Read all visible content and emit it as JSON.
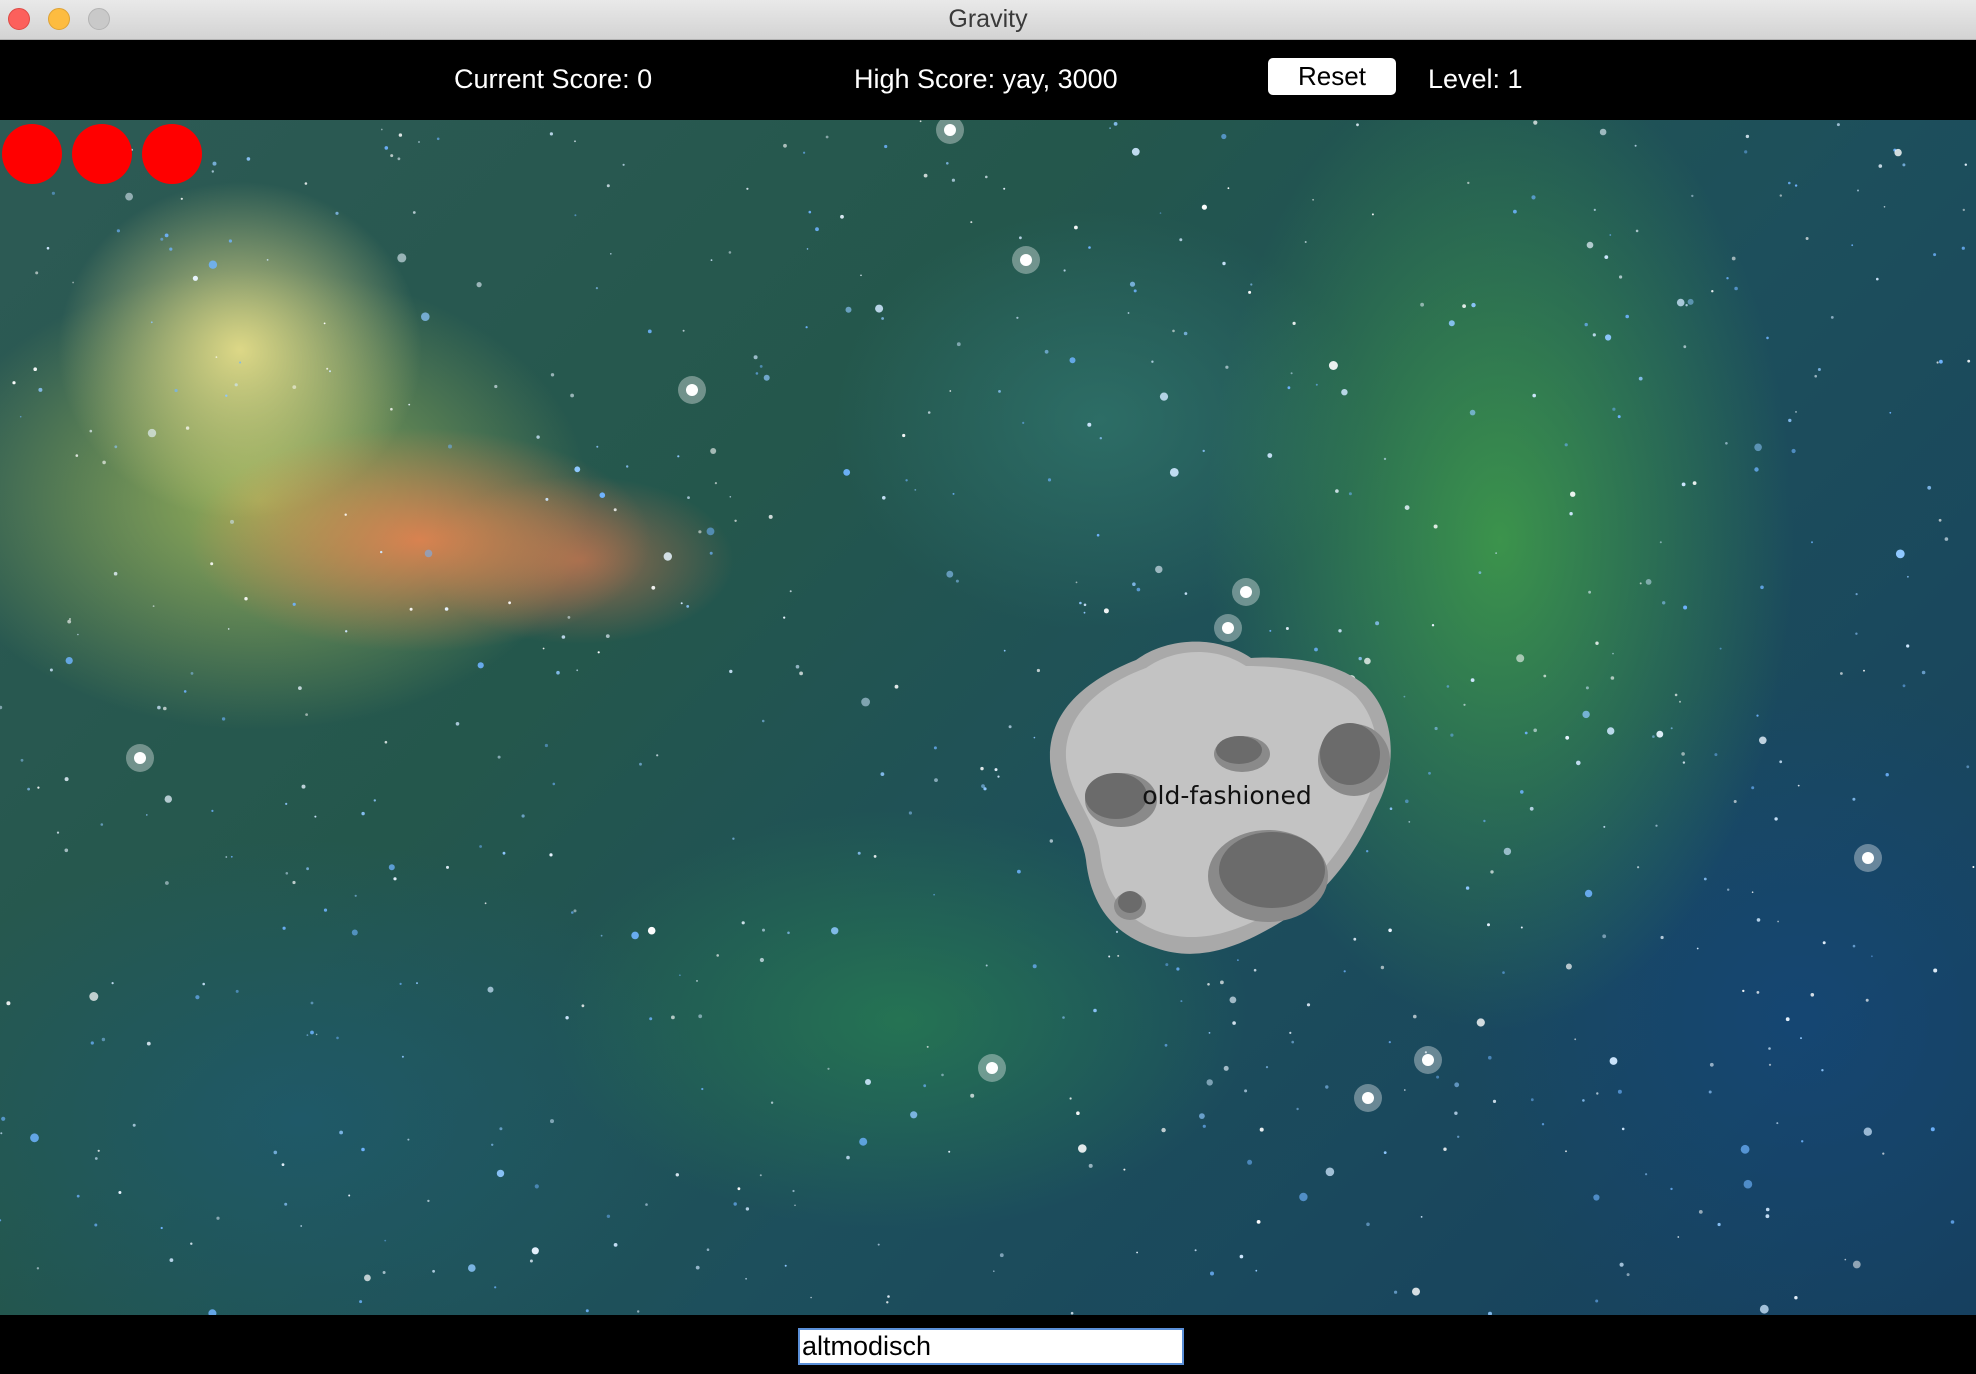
{
  "window": {
    "title": "Gravity"
  },
  "scorebar": {
    "current_score": "Current Score: 0",
    "high_score": "High Score: yay, 3000",
    "reset_label": "Reset",
    "level": "Level: 1"
  },
  "game": {
    "lives_remaining": 3,
    "life_color": "#ff0000",
    "asteroid_word": "old-fashioned",
    "background": "space-nebula"
  },
  "input": {
    "value": "altmodisch"
  }
}
